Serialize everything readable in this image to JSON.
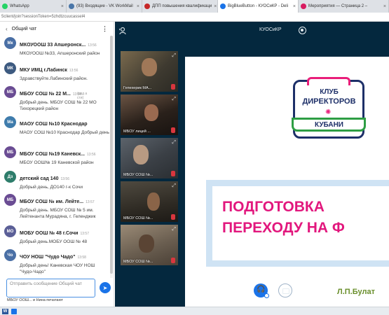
{
  "browser": {
    "tabs": [
      {
        "label": "WhatsApp",
        "color": "#25d366"
      },
      {
        "label": "(93) Входящие - VK WorkMail",
        "color": "#4a76a8"
      },
      {
        "label": "ДПП повышения квалификаци",
        "color": "#c62828"
      },
      {
        "label": "BigBlueButton - КУОСиКР - Deli",
        "color": "#1a73e8"
      },
      {
        "label": "Мероприятия — Страница 2 –",
        "color": "#d81b60"
      }
    ],
    "url": "5client/join?sessionToken=5zhdtzcuucassel4"
  },
  "chat": {
    "title": "Общий чат",
    "messages": [
      {
        "initials": "Мк",
        "color": "#4a6fa5",
        "name": "МКОУООШ 33 Апшеронск...",
        "time": "13:56",
        "text": "МКОУООШ №33, Апшеронский район"
      },
      {
        "initials": "МК",
        "color": "#3d5a80",
        "name": "МКУ ИМЦ г.Лабинск",
        "time": "13:56",
        "text": "Здравствуйте.Лабинский район."
      },
      {
        "initials": "МБ",
        "color": "#6a4c93",
        "name": "МБОУ СОШ № 22 М...",
        "time": "13:56",
        "edited": "(ред а\nсти)",
        "text": "Добрый день. МБОУ СОШ № 22 МО Тихорецкий район"
      },
      {
        "initials": "Ма",
        "color": "#3f7cac",
        "name": "МАОУ СОШ №10 Краснодар",
        "time": "",
        "text": "МАОУ СОШ №10 Краснодар Добрый день"
      },
      {
        "initials": "МБ",
        "color": "#6a4c93",
        "name": "МБОУ СОШ №19 Каневск...",
        "time": "13:56",
        "text": "МБОУ ООШ№ 19 Каневской район"
      },
      {
        "initials": "Дз",
        "color": "#2e7d6b",
        "name": "детский сад 140",
        "time": "13:56",
        "text": "Добрый день, ДО140 г-к Сочи"
      },
      {
        "initials": "МБ",
        "color": "#6a4c93",
        "name": "МБОУ СОШ № им. Лейте...",
        "time": "13:57",
        "text": "Добрый день. МБОУ СОШ № 5 им. Лейтенанта Мурадяна, г. Геленджик"
      },
      {
        "initials": "МО",
        "color": "#5b5f97",
        "name": "МОБУ ООШ № 48 г.Сочи",
        "time": "13:57",
        "text": "Добрый день.МОБУ ООШ № 48"
      },
      {
        "initials": "Чо",
        "color": "#4a6fa5",
        "name": "ЧОУ НОШ \"Чудо Чадо\"",
        "time": "13:58",
        "text": "Добрый день! Каневская ЧОУ НОШ \"Чудо-Чадо\""
      }
    ],
    "composer_placeholder": "Отправить сообщение Общий чат",
    "typing_text": "МБОУ ООШ... и Нина печатают"
  },
  "conference": {
    "title": "КУОСиКР",
    "tiles": [
      {
        "label": "Гепехерик МА..."
      },
      {
        "label": "МБОУ лицей ..."
      },
      {
        "label": "МБОУ СОШ №..."
      },
      {
        "label": "МБОУ СОШ №..."
      },
      {
        "label": "МБОУ СОШ №..."
      }
    ]
  },
  "slide": {
    "logo_lines": [
      "КЛУБ",
      "ДИРЕКТОРОВ",
      "КУБАНИ"
    ],
    "headline_lines": [
      "ПОДГОТОВКА",
      "ПЕРЕХОДУ НА Ф"
    ],
    "author": "Л.П.Булат"
  },
  "colors": {
    "accent": "#1a73e8",
    "slide_pink": "#e2177d",
    "logo_navy": "#1d2f68",
    "logo_green": "#2e9e44",
    "dark_bg": "#04283e"
  }
}
